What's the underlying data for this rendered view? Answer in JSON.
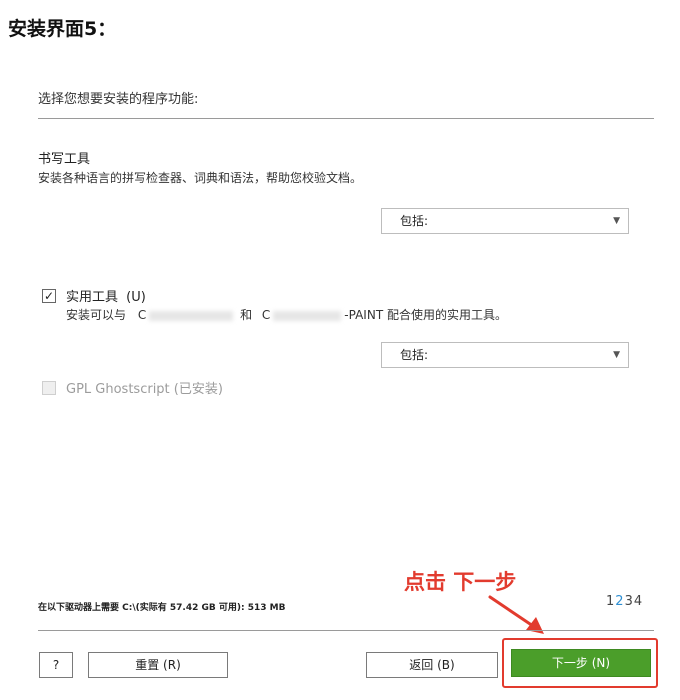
{
  "heading": "安装界面5：",
  "prompt": "选择您想要安装的程序功能:",
  "features": [
    {
      "title": "书写工具",
      "description": "安装各种语言的拼写检查器、词典和语法，帮助您校验文档。",
      "select_value": "包括:"
    },
    {
      "title": "实用工具",
      "shortcut": "(U)",
      "checked": true,
      "description_start": "安装可以与",
      "description_mid_1": "C",
      "description_mid_2": "和",
      "description_mid_3": "C",
      "description_end": "-PAINT 配合使用的实用工具。",
      "select_value": "包括:"
    },
    {
      "title": "GPL Ghostscript (已安装)",
      "checked": false,
      "disabled": true
    }
  ],
  "disk_info": "在以下驱动器上需要 C:\\(实际有 57.42 GB 可用): 513 MB",
  "pages": {
    "before": "1",
    "current": "2",
    "after": "34"
  },
  "annotation": "点击 下一步",
  "buttons": {
    "help": "?",
    "reset": "重置 (R)",
    "back": "返回 (B)",
    "next": "下一步 (N)"
  },
  "colors": {
    "primary_green": "#4b9e2a",
    "annotation_red": "#e23b2e",
    "page_current": "#2e8fd3"
  }
}
